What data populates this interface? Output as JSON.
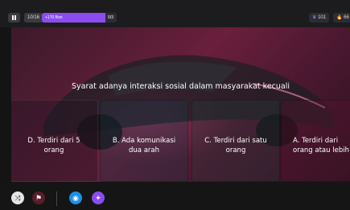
{
  "topbar": {
    "question_counter": "10/16",
    "progress": {
      "label": "+170 Bon",
      "value": "0/3",
      "fraction": 0.85
    },
    "score_pill": "101",
    "streak_pill": "66"
  },
  "question": {
    "text": "Syarat adanya interaksi sosial dalam masyarakat kecuali"
  },
  "options": [
    {
      "key": "D",
      "text_line1": "D. Terdiri dari 5",
      "text_line2": "orang"
    },
    {
      "key": "B",
      "text_line1": "B. Ada komunikasi",
      "text_line2": "dua arah"
    },
    {
      "key": "C",
      "text_line1": "C. Terdiri dari satu",
      "text_line2": "orang"
    },
    {
      "key": "A",
      "text_line1": "A. Terdiri dari",
      "text_line2": "orang atau lebih"
    }
  ],
  "bottombar": {
    "icons": [
      "leaderboard-icon",
      "flag-icon",
      "powerup-icon",
      "theme-icon"
    ]
  },
  "colors": {
    "accent": "#8c4cf0",
    "card": "#6a1f3c"
  }
}
